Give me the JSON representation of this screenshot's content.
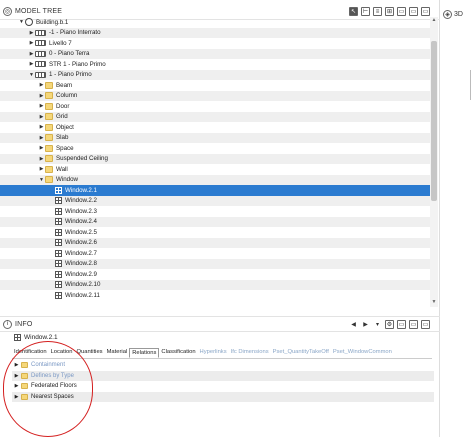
{
  "model_tree": {
    "title": "MODEL TREE",
    "tools": [
      "cursor-icon",
      "hierarchy-icon",
      "properties-icon",
      "structure-icon",
      "panel1-icon",
      "panel2-icon",
      "panel3-icon"
    ],
    "rows": [
      {
        "label": "Building.b.1",
        "indent": 2,
        "arrow": "▼",
        "icon": "building",
        "selected": false
      },
      {
        "label": "-1 - Piano Interrato",
        "indent": 3,
        "arrow": "▶",
        "icon": "story",
        "selected": false
      },
      {
        "label": "Livello 7",
        "indent": 3,
        "arrow": "▶",
        "icon": "story",
        "selected": false
      },
      {
        "label": "0 - Piano Terra",
        "indent": 3,
        "arrow": "▶",
        "icon": "story",
        "selected": false
      },
      {
        "label": "STR 1 - Piano Primo",
        "indent": 3,
        "arrow": "▶",
        "icon": "story",
        "selected": false
      },
      {
        "label": "1 - Piano Primo",
        "indent": 3,
        "arrow": "▼",
        "icon": "story",
        "selected": false
      },
      {
        "label": "Beam",
        "indent": 4,
        "arrow": "▶",
        "icon": "folder",
        "selected": false
      },
      {
        "label": "Column",
        "indent": 4,
        "arrow": "▶",
        "icon": "folder",
        "selected": false
      },
      {
        "label": "Door",
        "indent": 4,
        "arrow": "▶",
        "icon": "folder",
        "selected": false
      },
      {
        "label": "Grid",
        "indent": 4,
        "arrow": "▶",
        "icon": "folder",
        "selected": false
      },
      {
        "label": "Object",
        "indent": 4,
        "arrow": "▶",
        "icon": "folder",
        "selected": false
      },
      {
        "label": "Slab",
        "indent": 4,
        "arrow": "▶",
        "icon": "folder",
        "selected": false
      },
      {
        "label": "Space",
        "indent": 4,
        "arrow": "▶",
        "icon": "folder",
        "selected": false
      },
      {
        "label": "Suspended Ceiling",
        "indent": 4,
        "arrow": "▶",
        "icon": "folder",
        "selected": false
      },
      {
        "label": "Wall",
        "indent": 4,
        "arrow": "▶",
        "icon": "folder",
        "selected": false
      },
      {
        "label": "Window",
        "indent": 4,
        "arrow": "▼",
        "icon": "folder",
        "selected": false
      },
      {
        "label": "Window.2.1",
        "indent": 5,
        "arrow": "",
        "icon": "grid",
        "selected": true
      },
      {
        "label": "Window.2.2",
        "indent": 5,
        "arrow": "",
        "icon": "grid",
        "selected": false
      },
      {
        "label": "Window.2.3",
        "indent": 5,
        "arrow": "",
        "icon": "grid",
        "selected": false
      },
      {
        "label": "Window.2.4",
        "indent": 5,
        "arrow": "",
        "icon": "grid",
        "selected": false
      },
      {
        "label": "Window.2.5",
        "indent": 5,
        "arrow": "",
        "icon": "grid",
        "selected": false
      },
      {
        "label": "Window.2.6",
        "indent": 5,
        "arrow": "",
        "icon": "grid",
        "selected": false
      },
      {
        "label": "Window.2.7",
        "indent": 5,
        "arrow": "",
        "icon": "grid",
        "selected": false
      },
      {
        "label": "Window.2.8",
        "indent": 5,
        "arrow": "",
        "icon": "grid",
        "selected": false
      },
      {
        "label": "Window.2.9",
        "indent": 5,
        "arrow": "",
        "icon": "grid",
        "selected": false
      },
      {
        "label": "Window.2.10",
        "indent": 5,
        "arrow": "",
        "icon": "grid",
        "selected": false
      },
      {
        "label": "Window.2.11",
        "indent": 5,
        "arrow": "",
        "icon": "grid",
        "selected": false
      }
    ]
  },
  "view3d": {
    "label": "3D"
  },
  "info": {
    "title": "INFO",
    "element_title": "Window.2.1",
    "tabs": [
      {
        "label": "Identification",
        "state": "normal"
      },
      {
        "label": "Location",
        "state": "normal"
      },
      {
        "label": "Quantities",
        "state": "normal"
      },
      {
        "label": "Material",
        "state": "normal"
      },
      {
        "label": "Relations",
        "state": "active"
      },
      {
        "label": "Classification",
        "state": "normal"
      },
      {
        "label": "Hyperlinks",
        "state": "dim"
      },
      {
        "label": "Ifc Dimensions",
        "state": "dim"
      },
      {
        "label": "Pset_QuantityTakeOff",
        "state": "dim"
      },
      {
        "label": "Pset_WindowCommon",
        "state": "dim"
      }
    ],
    "relations": [
      {
        "label": "Containment",
        "dim": true
      },
      {
        "label": "Defines by Type",
        "dim": true
      },
      {
        "label": "Federated Floors",
        "dim": false
      },
      {
        "label": "Nearest Spaces",
        "dim": false
      }
    ]
  },
  "colors": {
    "selection": "#2b7bd0",
    "annotation": "#d42020",
    "folder": "#f5d77a"
  }
}
